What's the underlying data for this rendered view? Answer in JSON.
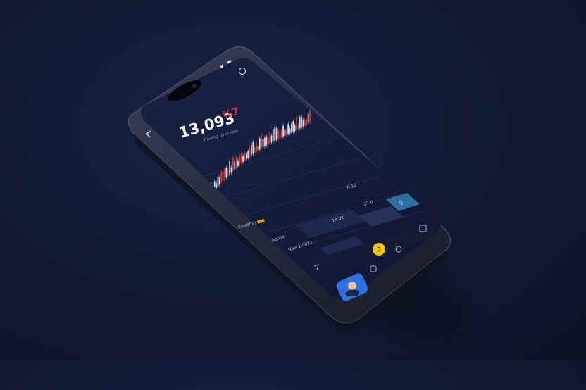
{
  "hero": {
    "price_main": "13,093",
    "price_suffix": "%7",
    "subtitle": "Trading overview"
  },
  "colors": {
    "background": "#0f1730",
    "phone_frame": "#2b3147",
    "screen": "#141d3b",
    "accent_red": "#e0303a",
    "accent_yellow": "#f2c512",
    "accent_blue": "#2f6fe0",
    "candle_up": "#d2d6e0",
    "candle_down": "#c23a3a"
  },
  "rows": [
    {
      "label": "Crossbuy",
      "value": "0.12"
    },
    {
      "label": "Apoller",
      "value": "14:02"
    },
    {
      "label": "Nazi 1:0022",
      "value": "27:0"
    }
  ],
  "icons": [
    "back-icon",
    "notification-icon",
    "signal-icon",
    "battery-icon",
    "settings-icon",
    "wallet-icon",
    "chart-icon",
    "menu-icon",
    "coin-icon",
    "avatar"
  ]
}
